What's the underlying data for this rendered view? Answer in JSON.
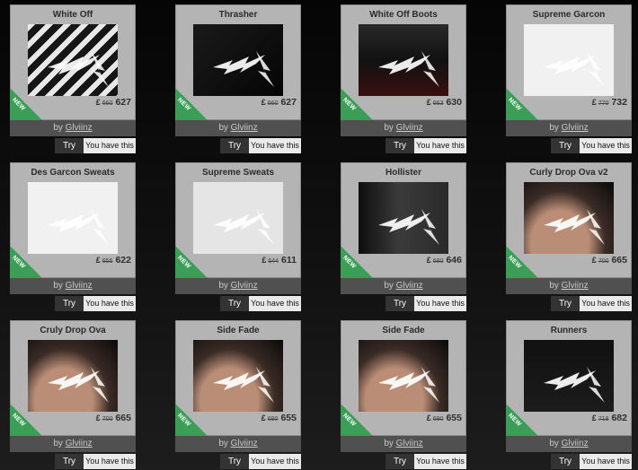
{
  "common": {
    "by_label": "by",
    "new_badge": "NEW",
    "try_label": "Try",
    "owned_label": "You have this",
    "currency_symbol": "£"
  },
  "items": [
    {
      "title": "White Off",
      "old_price": "660",
      "price": "627",
      "author": "Glviinz",
      "art": "stripes"
    },
    {
      "title": "Thrasher",
      "old_price": "660",
      "price": "627",
      "author": "Glviinz",
      "art": "dark"
    },
    {
      "title": "White Off Boots",
      "old_price": "663",
      "price": "630",
      "author": "Glviinz",
      "art": "boots"
    },
    {
      "title": "Supreme Garcon",
      "old_price": "770",
      "price": "732",
      "author": "Glviinz",
      "art": "hearts"
    },
    {
      "title": "Des Garcon Sweats",
      "old_price": "655",
      "price": "622",
      "author": "Glviinz",
      "art": "hearts"
    },
    {
      "title": "Supreme Sweats",
      "old_price": "644",
      "price": "611",
      "author": "Glviinz",
      "art": "sweats"
    },
    {
      "title": "Hollister",
      "old_price": "680",
      "price": "646",
      "author": "Glviinz",
      "art": "hollister"
    },
    {
      "title": "Curly Drop Ova v2",
      "old_price": "700",
      "price": "665",
      "author": "Glviinz",
      "art": "face"
    },
    {
      "title": "Cruly Drop Ova",
      "old_price": "700",
      "price": "665",
      "author": "Glviinz",
      "art": "face"
    },
    {
      "title": "Side Fade",
      "old_price": "690",
      "price": "655",
      "author": "Glviinz",
      "art": "face"
    },
    {
      "title": "Side Fade",
      "old_price": "690",
      "price": "655",
      "author": "Glviinz",
      "art": "face"
    },
    {
      "title": "Runners",
      "old_price": "718",
      "price": "682",
      "author": "Glviinz",
      "art": "runners"
    }
  ],
  "colors": {
    "new_badge": "#3a9e57",
    "card": "#b4b4b4",
    "byline": "#505050",
    "try": "#333333",
    "owned": "#eaeaea"
  }
}
